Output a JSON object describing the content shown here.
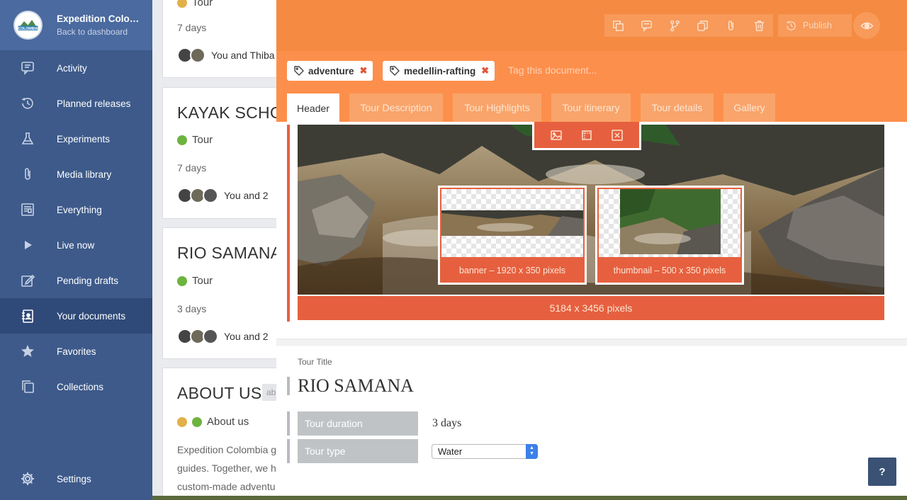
{
  "sidebar": {
    "site_name": "Expedition Colombia",
    "back_label": "Back to dashboard",
    "logo_text": "COLOMBIA",
    "items": [
      {
        "label": "Activity",
        "icon": "chat-icon"
      },
      {
        "label": "Planned releases",
        "icon": "history-icon"
      },
      {
        "label": "Experiments",
        "icon": "flask-icon"
      },
      {
        "label": "Media library",
        "icon": "paperclip-icon"
      },
      {
        "label": "Everything",
        "icon": "newspaper-icon"
      },
      {
        "label": "Live now",
        "icon": "play-icon"
      },
      {
        "label": "Pending drafts",
        "icon": "edit-icon"
      },
      {
        "label": "Your documents",
        "icon": "document-user-icon",
        "active": true
      },
      {
        "label": "Favorites",
        "icon": "star-icon"
      },
      {
        "label": "Collections",
        "icon": "collections-icon"
      }
    ],
    "settings_label": "Settings"
  },
  "list": {
    "cards": [
      {
        "status": "Tour",
        "days": "7 days",
        "people": "You and Thiba"
      },
      {
        "title": "KAYAK SCHO",
        "status": "Tour",
        "days": "7 days",
        "people": "You and 2"
      },
      {
        "title": "RIO SAMANA",
        "status": "Tour",
        "days": "3 days",
        "people": "You and 2"
      },
      {
        "title": "ABOUT US",
        "badge": "ab",
        "status": "About us",
        "body_lines": [
          "Expedition Colombia g",
          "guides. Together, we h",
          "custom-made adventu"
        ]
      }
    ]
  },
  "toolbar": {
    "icons": [
      "duplicate-icon",
      "comment-icon",
      "branch-icon",
      "copy-icon",
      "paperclip-icon",
      "trash-icon"
    ],
    "publish_label": "Publish",
    "preview_icon": "eye-icon"
  },
  "tags": {
    "items": [
      "adventure",
      "medellin-rafting"
    ],
    "placeholder": "Tag this document..."
  },
  "tabs": [
    "Header",
    "Tour Description",
    "Tour Highlights",
    "Tour itinerary",
    "Tour details",
    "Gallery"
  ],
  "image": {
    "dimensions": "5184 x 3456 pixels",
    "tools": [
      "image-icon",
      "crop-icon",
      "remove-icon"
    ],
    "views": [
      {
        "label": "banner – 1920 x 350 pixels"
      },
      {
        "label": "thumbnail – 500 x 350 pixels"
      }
    ]
  },
  "form": {
    "title_label": "Tour Title",
    "title_value": "RIO SAMANA",
    "duration_label": "Tour duration",
    "duration_value": "3 days",
    "type_label": "Tour type",
    "type_value": "Water"
  },
  "help_label": "?",
  "colors": {
    "sidebar": "#3d5a8a",
    "accent_orange": "#f58a42",
    "image_accent": "#e6603f",
    "status_green": "#6cb33f"
  }
}
